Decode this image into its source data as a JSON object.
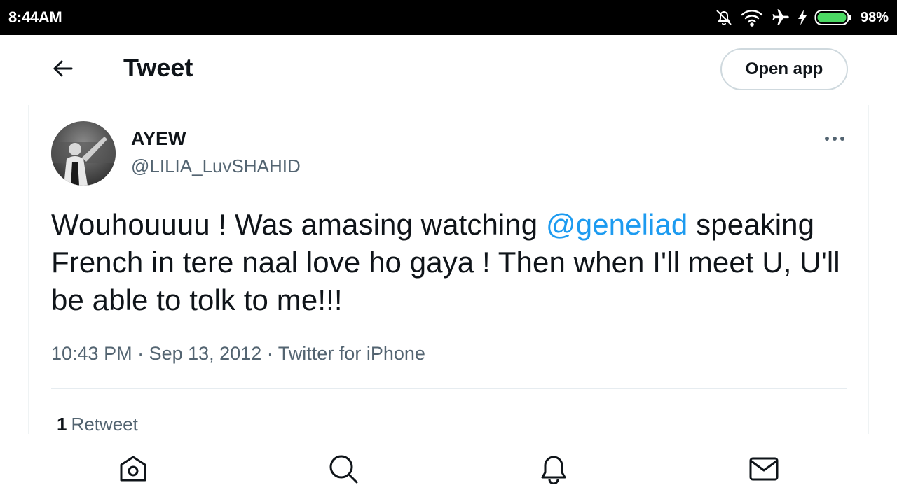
{
  "status_bar": {
    "time": "8:44AM",
    "battery_percent": "98%",
    "icons": [
      "notifications-off-icon",
      "wifi-icon",
      "airplane-mode-icon",
      "charging-icon",
      "battery-icon"
    ]
  },
  "header": {
    "back_icon": "back-arrow-icon",
    "title": "Tweet",
    "open_app_label": "Open app"
  },
  "tweet": {
    "author": {
      "name": "AYEW",
      "handle": "@LILIA_LuvSHAHID",
      "avatar_icon": "avatar"
    },
    "text_before_mention": "Wouhouuuu ! Was amasing watching ",
    "mention": "@geneliad",
    "text_after_mention": " speaking French in tere naal love ho gaya ! Then when I'll meet U, U'll be able to tolk to me!!!",
    "time": "10:43 PM",
    "date": "Sep 13, 2012",
    "separator": "·",
    "source": "Twitter for iPhone",
    "retweet_count": "1",
    "retweet_label": "Retweet",
    "more_icon": "more-options-icon"
  },
  "bottom_nav": {
    "items": [
      {
        "icon": "home-icon"
      },
      {
        "icon": "search-icon"
      },
      {
        "icon": "notifications-icon"
      },
      {
        "icon": "messages-icon"
      }
    ]
  },
  "colors": {
    "link": "#1d9bf0",
    "secondary_text": "#536471",
    "primary_text": "#0f1419",
    "border": "#cfd9de",
    "battery": "#4cd964"
  }
}
